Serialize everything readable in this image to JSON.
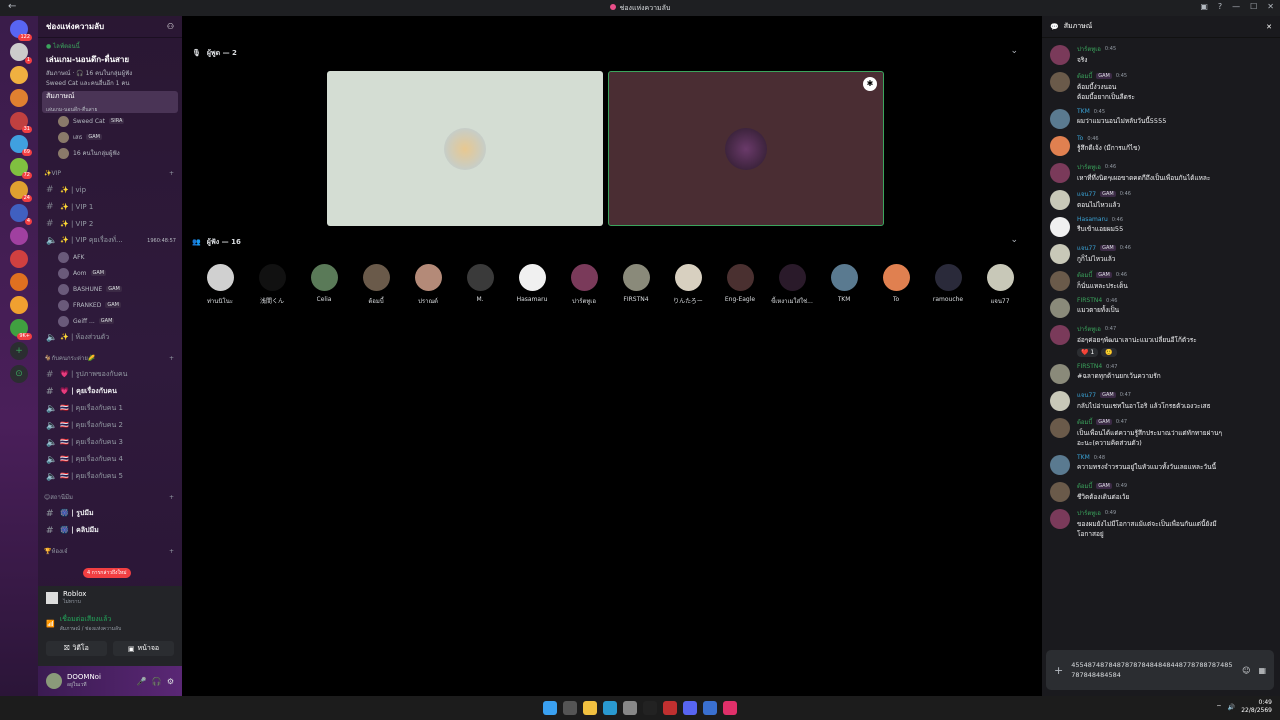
{
  "window": {
    "title": "ช่องแห่งความลับ"
  },
  "server": {
    "name": "ช่องแห่งความลับ",
    "event_live": "● ไลฟ์ตอนนี้",
    "event_name": "เล่นเกม-นอนดึก-ตื่นสาย",
    "event_sub1": "สัมภาษณ์ · 🎧 16 คนในกลุ่มผู้ฟัง",
    "event_sub2": "Sweed Cat และคนอื่นอีก 1 คน"
  },
  "stage_channel": {
    "name": "สัมภาษณ์",
    "sub": "เล่นเกม-นอนดึก-ตื่นสาย"
  },
  "stage_users": [
    {
      "name": "Sweed Cat",
      "tag": "SIRA"
    },
    {
      "name": "เสธ",
      "tag": "GAM"
    },
    {
      "name": "16 คนในกลุ่มผู้ฟัง",
      "tag": ""
    }
  ],
  "cat_vip": "✨VIP",
  "vip_channels": [
    "✨ | vip",
    "✨ | VIP 1",
    "✨ | VIP 2",
    "✨ | VIP คุยเรื่องทั่..."
  ],
  "vip_timer": "1960:48:57",
  "vip_users": [
    {
      "name": "AFK",
      "tag": ""
    },
    {
      "name": "Aom",
      "tag": "GAM"
    },
    {
      "name": "BASHUNE",
      "tag": "GAM"
    },
    {
      "name": "FRANKED",
      "tag": "GAM"
    },
    {
      "name": "Geiff ...",
      "tag": "GAM"
    }
  ],
  "private_room": "✨ | ห้องส่วนตัว",
  "cat_couple": "🐐กับคนกระต่าย🌽",
  "couple_channels": [
    "💗 | รูปภาพของกับคน",
    "💗 | คุยเรื่องกับคน",
    "🇹🇭 | คุยเรื่องกับคน 1",
    "🇹🇭 | คุยเรื่องกับคน 2",
    "🇹🇭 | คุยเรื่องกับคน 3",
    "🇹🇭 | คุยเรื่องกับคน 4",
    "🇹🇭 | คุยเรื่องกับคน 5"
  ],
  "cat_meme": "😊สถานีมีม",
  "meme_channels": [
    "🎆 | รูปมีม",
    "🎆 | คลิปมีม"
  ],
  "cat_more": "🏆ห้องเจ๋",
  "unread_pill": "4 การกล่าวถึงใหม่",
  "voice_panel": {
    "game": "Roblox",
    "game_sub": "ไม่ทราบ",
    "connected": "เชื่อมต่อเสียงแล้ว",
    "location": "สัมภาษณ์ / ช่องแห่งความลับ",
    "video": "วิดีโอ",
    "screen": "หน้าจอ"
  },
  "user": {
    "name": "DOOMNoi",
    "status": "อยู่ในเวที"
  },
  "speakers_label": "ผู้พูด — 2",
  "listeners_label": "ผู้ฟัง — 16",
  "listeners": [
    {
      "name": "ท่านนิโนะ",
      "color": "#d0d0d0"
    },
    {
      "name": "浅間くん",
      "color": "#111"
    },
    {
      "name": "Celia",
      "color": "#5a7a58"
    },
    {
      "name": "ต้อมบี้",
      "color": "#6a5a4a"
    },
    {
      "name": "ปราณต์",
      "color": "#b48a78"
    },
    {
      "name": "M.",
      "color": "#3a3a3a"
    },
    {
      "name": "Hasamaru",
      "color": "#f0f0f0"
    },
    {
      "name": "ปาร์ตทูเอ",
      "color": "#7a3a5a"
    },
    {
      "name": "FIRSTN4",
      "color": "#8a8a7a"
    },
    {
      "name": "りんたろー",
      "color": "#d8d0c0"
    },
    {
      "name": "Eng-Eagle",
      "color": "#4a3030"
    },
    {
      "name": "ขี้เหงาเมใส่ใช่...",
      "color": "#2a1a2a"
    },
    {
      "name": "TKM",
      "color": "#5a7a90"
    },
    {
      "name": "To",
      "color": "#e08050"
    },
    {
      "name": "ramouche",
      "color": "#2a2a3a"
    },
    {
      "name": "แจน77",
      "color": "#c8c8b8"
    }
  ],
  "chat": {
    "title": "สัมภาษณ์",
    "messages": [
      {
        "author": "ปาร์ตทูเอ",
        "time": "0:45",
        "text": "จริง",
        "color": "green",
        "av": "#7a3a5a",
        "tag": "",
        "react": []
      },
      {
        "author": "ต้อมบี้",
        "time": "0:45",
        "text": "ต้อมบี้ง่วงนอน\nต้อมบี้อยากเป็นลีดระ",
        "color": "green",
        "av": "#6a5a4a",
        "tag": "GAM",
        "react": []
      },
      {
        "author": "TKM",
        "time": "0:45",
        "text": "ผมว่าแมวนอนไม่หลับวันนี้5555",
        "color": "blue",
        "av": "#5a7a90",
        "tag": "",
        "react": []
      },
      {
        "author": "To",
        "time": "0:46",
        "text": "รู้สึกดีเจ้ง (มีการแก้ไข)",
        "color": "blue",
        "av": "#e08050",
        "tag": "",
        "react": []
      },
      {
        "author": "ปาร์ตทูเอ",
        "time": "0:46",
        "text": "เหาที่ทึ่งนิดๆเผอขาดคดกีถึงเป็นเพื่อนกันได้แหละ",
        "color": "green",
        "av": "#7a3a5a",
        "tag": "",
        "react": []
      },
      {
        "author": "แจน77",
        "time": "0:46",
        "text": "ตอนไม่ไหวแล้ว",
        "color": "blue",
        "av": "#c8c8b8",
        "tag": "GAM",
        "react": []
      },
      {
        "author": "Hasamaru",
        "time": "0:46",
        "text": "รีบเข้าแอยผม55",
        "color": "blue",
        "av": "#f0f0f0",
        "tag": "",
        "react": []
      },
      {
        "author": "แจน77",
        "time": "0:46",
        "text": "กูก็ไม่ไหวแล้ว",
        "color": "blue",
        "av": "#c8c8b8",
        "tag": "GAM",
        "react": []
      },
      {
        "author": "ต้อมบี้",
        "time": "0:46",
        "text": "ก็นั่นแหละประเด็น",
        "color": "green",
        "av": "#6a5a4a",
        "tag": "GAM",
        "react": []
      },
      {
        "author": "FIRSTN4",
        "time": "0:46",
        "text": "แมวตายทั้งเป็น",
        "color": "green",
        "av": "#8a8a7a",
        "tag": "",
        "react": []
      },
      {
        "author": "ปาร์ตทูเอ",
        "time": "0:47",
        "text": "อ่อๆค่อยๆพัฒนาเลาน่ะแมวเปลี่ยนอีโก้ตัวระ",
        "color": "green",
        "av": "#7a3a5a",
        "tag": "",
        "react": [
          "❤️ 1",
          "🙂"
        ]
      },
      {
        "author": "FIRSTN4",
        "time": "0:47",
        "text": "#ฉลาดทุกด้านยกเว้นความรัก",
        "color": "green",
        "av": "#8a8a7a",
        "tag": "",
        "react": []
      },
      {
        "author": "แจน77",
        "time": "0:47",
        "text": "กลับไปอ่านแชทในอาโอริ แล้วโกรธตัวเองวะเสธ",
        "color": "blue",
        "av": "#c8c8b8",
        "tag": "GAM",
        "react": []
      },
      {
        "author": "ต้อมบี้",
        "time": "0:47",
        "text": "เป็นเพื่อนได้แต่ความรู้สึกประมาณว่าแต่ทักทายผ่านๆ\nอะนะ(ความคิดส่วนตัว)",
        "color": "green",
        "av": "#6a5a4a",
        "tag": "GAM",
        "react": []
      },
      {
        "author": "TKM",
        "time": "0:48",
        "text": "ความทรงจำวรวนอยู่ในหัวแมวทั้งวันเลยแหละวันนี้",
        "color": "blue",
        "av": "#5a7a90",
        "tag": "",
        "react": []
      },
      {
        "author": "ต้อมบี้",
        "time": "0:49",
        "text": "ชีวิตต้องเดินต่อเว้ย",
        "color": "green",
        "av": "#6a5a4a",
        "tag": "GAM",
        "react": []
      },
      {
        "author": "ปาร์ตทูเอ",
        "time": "0:49",
        "text": "ของผมยังไม่มีโอกาสแม้แต่จะเป็นเพื่อนกันแต่นี้ยังมี\nโอกาสอยู่",
        "color": "green",
        "av": "#7a3a5a",
        "tag": "",
        "react": []
      }
    ],
    "input_text": "455487487848787878484848448778788787485787848484584"
  },
  "taskbar": {
    "time": "0:49",
    "date": "22/8/2569"
  },
  "guild_badges": [
    "122",
    "1",
    "",
    "",
    "31",
    "69",
    "72",
    "24",
    "4",
    "",
    "",
    "",
    "",
    "9K+"
  ]
}
